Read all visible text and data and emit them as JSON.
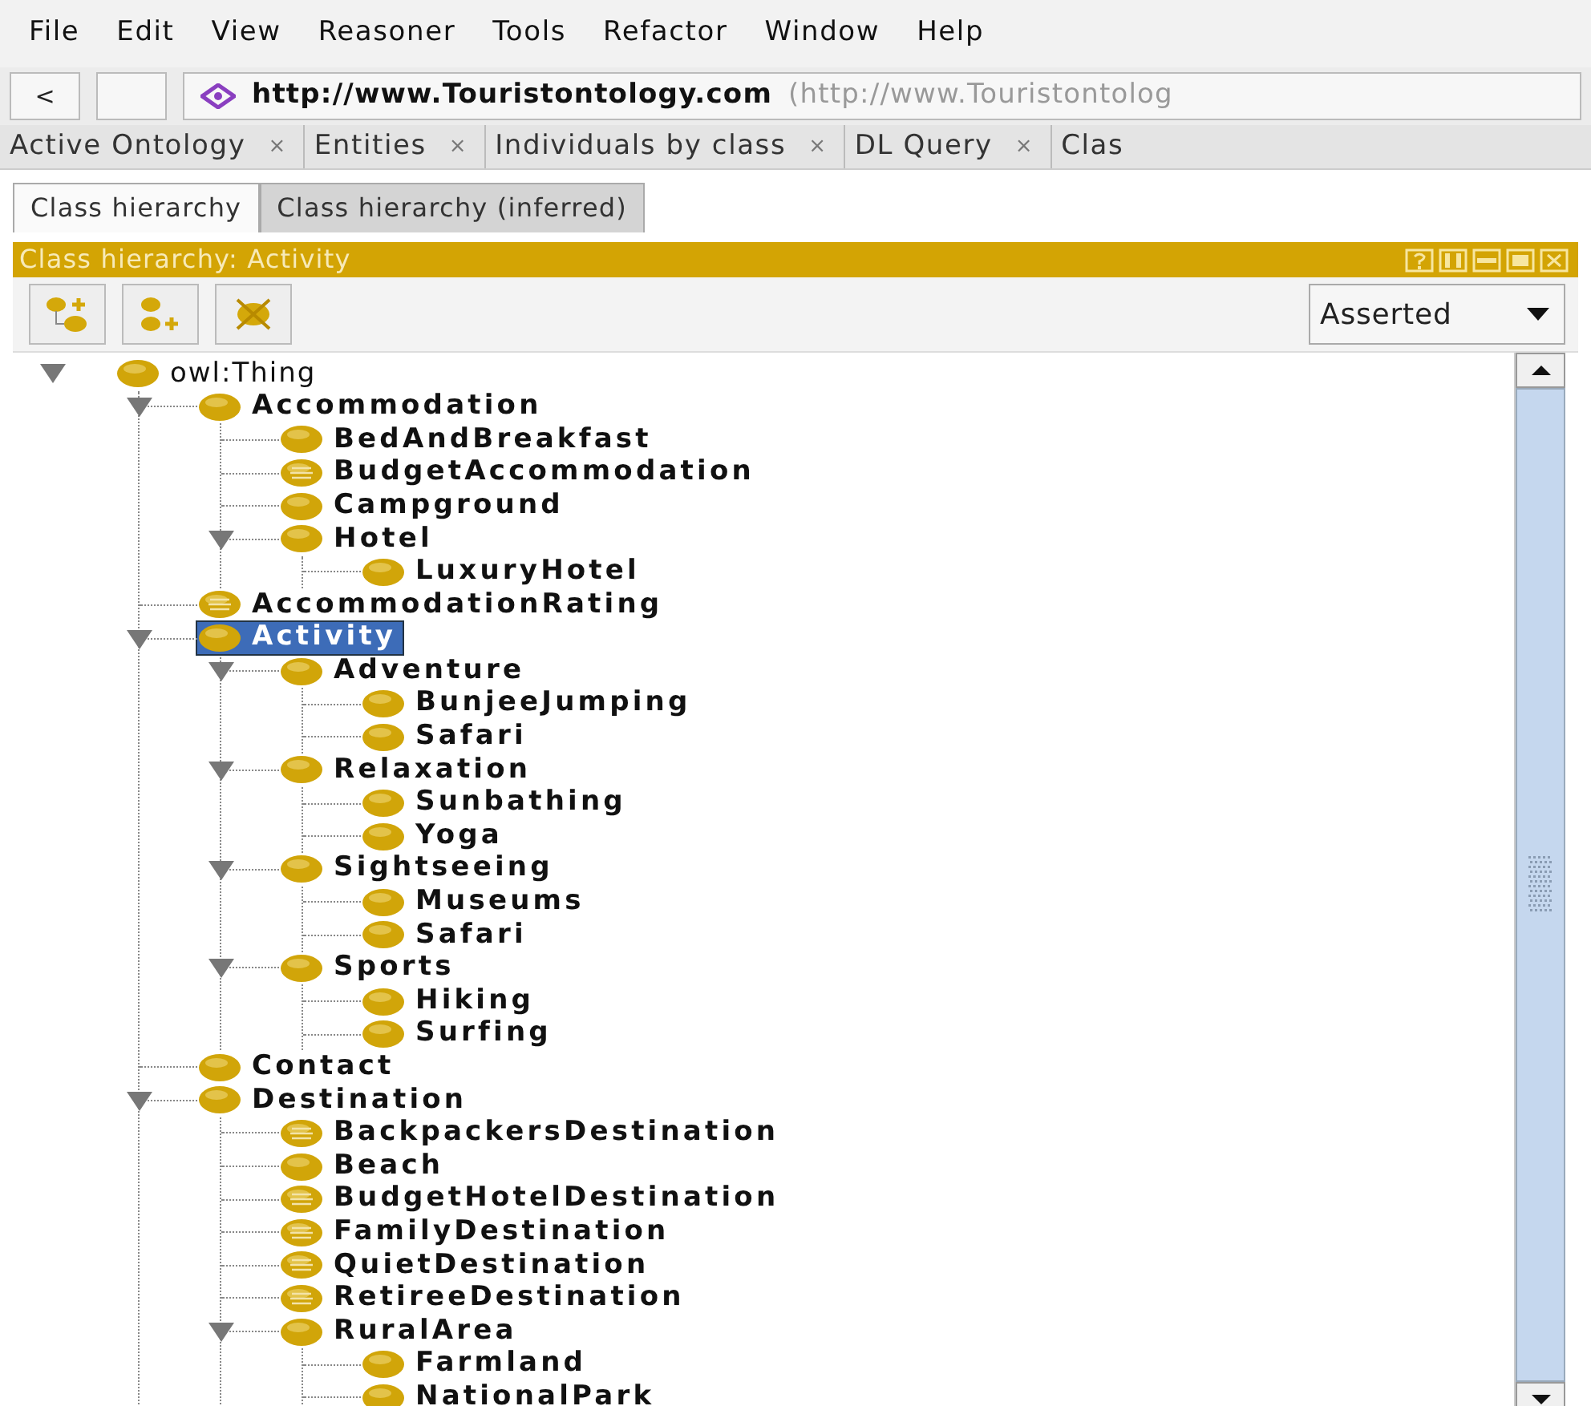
{
  "menu": [
    "File",
    "Edit",
    "View",
    "Reasoner",
    "Tools",
    "Refactor",
    "Window",
    "Help"
  ],
  "nav": {
    "back": "<",
    "url": "http://www.Touristontology.com",
    "url_detail": "(http://www.Touristontolog"
  },
  "tabs": [
    {
      "label": "Active Ontology",
      "close": "×"
    },
    {
      "label": "Entities",
      "close": "×"
    },
    {
      "label": "Individuals by class",
      "close": "×"
    },
    {
      "label": "DL Query",
      "close": "×"
    },
    {
      "label": "Clas"
    }
  ],
  "subtabs": [
    {
      "label": "Class hierarchy",
      "selected": true
    },
    {
      "label": "Class hierarchy (inferred)",
      "selected": false
    }
  ],
  "view": {
    "title": "Class hierarchy: Activity"
  },
  "mode": {
    "value": "Asserted"
  },
  "tree": [
    {
      "label": "owl:Thing",
      "kind": "primitive",
      "expanded": true,
      "selected": false,
      "children": [
        {
          "label": "Accommodation",
          "kind": "primitive",
          "expanded": true,
          "selected": false,
          "children": [
            {
              "label": "BedAndBreakfast",
              "kind": "primitive",
              "selected": false
            },
            {
              "label": "BudgetAccommodation",
              "kind": "defined",
              "selected": false
            },
            {
              "label": "Campground",
              "kind": "primitive",
              "selected": false
            },
            {
              "label": "Hotel",
              "kind": "primitive",
              "expanded": true,
              "selected": false,
              "children": [
                {
                  "label": "LuxuryHotel",
                  "kind": "primitive",
                  "selected": false
                }
              ]
            }
          ]
        },
        {
          "label": "AccommodationRating",
          "kind": "defined",
          "selected": false
        },
        {
          "label": "Activity",
          "kind": "primitive",
          "expanded": true,
          "selected": true,
          "children": [
            {
              "label": "Adventure",
              "kind": "primitive",
              "expanded": true,
              "selected": false,
              "children": [
                {
                  "label": "BunjeeJumping",
                  "kind": "primitive",
                  "selected": false
                },
                {
                  "label": "Safari",
                  "kind": "primitive",
                  "selected": false
                }
              ]
            },
            {
              "label": "Relaxation",
              "kind": "primitive",
              "expanded": true,
              "selected": false,
              "children": [
                {
                  "label": "Sunbathing",
                  "kind": "primitive",
                  "selected": false
                },
                {
                  "label": "Yoga",
                  "kind": "primitive",
                  "selected": false
                }
              ]
            },
            {
              "label": "Sightseeing",
              "kind": "primitive",
              "expanded": true,
              "selected": false,
              "children": [
                {
                  "label": "Museums",
                  "kind": "primitive",
                  "selected": false
                },
                {
                  "label": "Safari",
                  "kind": "primitive",
                  "selected": false
                }
              ]
            },
            {
              "label": "Sports",
              "kind": "primitive",
              "expanded": true,
              "selected": false,
              "children": [
                {
                  "label": "Hiking",
                  "kind": "primitive",
                  "selected": false
                },
                {
                  "label": "Surfing",
                  "kind": "primitive",
                  "selected": false
                }
              ]
            }
          ]
        },
        {
          "label": "Contact",
          "kind": "primitive",
          "selected": false
        },
        {
          "label": "Destination",
          "kind": "primitive",
          "expanded": true,
          "selected": false,
          "children": [
            {
              "label": "BackpackersDestination",
              "kind": "defined",
              "selected": false
            },
            {
              "label": "Beach",
              "kind": "primitive",
              "selected": false
            },
            {
              "label": "BudgetHotelDestination",
              "kind": "defined",
              "selected": false
            },
            {
              "label": "FamilyDestination",
              "kind": "defined",
              "selected": false
            },
            {
              "label": "QuietDestination",
              "kind": "defined",
              "selected": false
            },
            {
              "label": "RetireeDestination",
              "kind": "defined",
              "selected": false
            },
            {
              "label": "RuralArea",
              "kind": "primitive",
              "expanded": true,
              "selected": false,
              "children": [
                {
                  "label": "Farmland",
                  "kind": "primitive",
                  "selected": false
                },
                {
                  "label": "NationalPark",
                  "kind": "primitive",
                  "selected": false
                }
              ]
            }
          ]
        }
      ]
    }
  ]
}
